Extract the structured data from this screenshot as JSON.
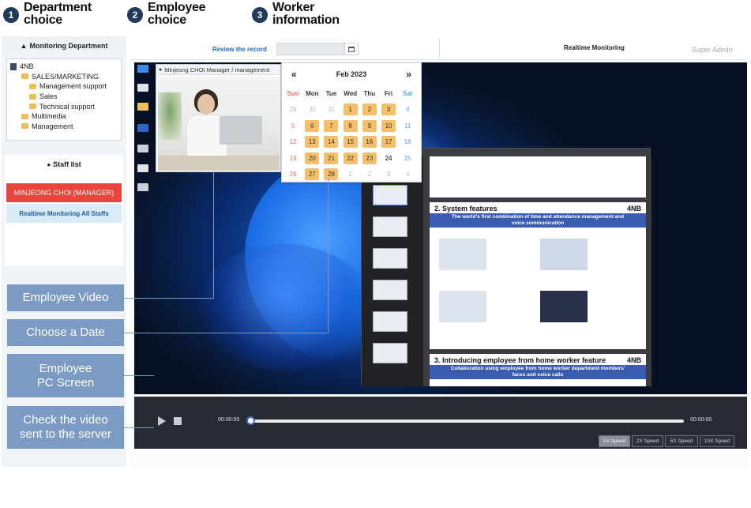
{
  "steps": [
    {
      "number": "1",
      "line1": "Department",
      "line2": "choice"
    },
    {
      "number": "2",
      "line1": "Employee",
      "line2": "choice"
    },
    {
      "number": "3",
      "line1": "Worker",
      "line2": "information"
    }
  ],
  "sidebar": {
    "monitoring_title": "Monitoring Department",
    "tree": [
      {
        "label": "4NB"
      },
      {
        "label": "SALES/MARKETING"
      },
      {
        "label": "Management support"
      },
      {
        "label": "Sales"
      },
      {
        "label": "Technical support"
      },
      {
        "label": "Multimedia"
      },
      {
        "label": "Management"
      }
    ],
    "staff_title": "Staff list",
    "staff_selected": "MINJEONG CHOI (MANAGER)",
    "staff_all": "Realtime Monitoring All Staffs"
  },
  "callouts": {
    "employee_video": "Employee Video",
    "choose_date": "Choose a Date",
    "pc_screen_line1": "Employee",
    "pc_screen_line2": "PC Screen",
    "check_video_line1": "Check the video",
    "check_video_line2": "sent to the server"
  },
  "header": {
    "review_label": "Review the record",
    "date_value": "",
    "realtime_title": "Realtime Monitoring",
    "user": "Super Admin"
  },
  "webcam": {
    "caption": "Minjeong CHOI Manager / management"
  },
  "calendar": {
    "month_label": "Feb 2023",
    "prev": "«",
    "next": "»",
    "weekdays": [
      "Sun",
      "Mon",
      "Tue",
      "Wed",
      "Thu",
      "Fri",
      "Sat"
    ],
    "days": [
      {
        "d": "29",
        "muted": true
      },
      {
        "d": "30",
        "muted": true
      },
      {
        "d": "31",
        "muted": true
      },
      {
        "d": "1",
        "rec": true
      },
      {
        "d": "2",
        "rec": true
      },
      {
        "d": "3",
        "rec": true
      },
      {
        "d": "4"
      },
      {
        "d": "5"
      },
      {
        "d": "6",
        "rec": true
      },
      {
        "d": "7",
        "rec": true
      },
      {
        "d": "8",
        "rec": true
      },
      {
        "d": "9",
        "rec": true
      },
      {
        "d": "10",
        "rec": true
      },
      {
        "d": "11"
      },
      {
        "d": "12"
      },
      {
        "d": "13",
        "rec": true
      },
      {
        "d": "14",
        "rec": true
      },
      {
        "d": "15",
        "rec": true
      },
      {
        "d": "16",
        "rec": true
      },
      {
        "d": "17",
        "rec": true
      },
      {
        "d": "18"
      },
      {
        "d": "19"
      },
      {
        "d": "20",
        "rec": true
      },
      {
        "d": "21",
        "rec": true
      },
      {
        "d": "22",
        "rec": true
      },
      {
        "d": "23",
        "rec": true
      },
      {
        "d": "24"
      },
      {
        "d": "25"
      },
      {
        "d": "26"
      },
      {
        "d": "27",
        "rec": true
      },
      {
        "d": "28",
        "rec": true
      },
      {
        "d": "1",
        "muted": true
      },
      {
        "d": "2",
        "muted": true
      },
      {
        "d": "3",
        "muted": true
      },
      {
        "d": "4",
        "muted": true
      }
    ]
  },
  "slides": {
    "slide2_title": "2. System features",
    "slide2_sub": "The world's first combination of time and attendance management and voice communication",
    "slide3_title": "3. Introducing employee from home worker feature",
    "slide3_sub": "Collaboration using employee from home worker department members' faces and voice calls",
    "logo": "4NB"
  },
  "player": {
    "time_current": "00:00:00",
    "time_total": "00:00:00",
    "progress": 0,
    "speeds": [
      "1X Speed",
      "2X Speed",
      "5X Speed",
      "10X Speed"
    ],
    "active_speed": "1X Speed"
  },
  "colors": {
    "accent": "#1f3a5a",
    "callout": "#7b9bc4",
    "record_day": "#f6c06b",
    "selected_staff": "#e8453c"
  }
}
